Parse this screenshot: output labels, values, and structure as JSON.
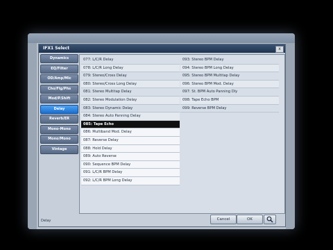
{
  "dialog": {
    "title": "IFX1 Select",
    "close_label": "x"
  },
  "categories": [
    "Dynamics",
    "EQ/Filter",
    "OD/Amp/Mic",
    "Cho/Flg/Phs",
    "Mod/P.Shift",
    "Delay",
    "Reverb/ER",
    "Mono-Mono",
    "Mono/Mono",
    "Vintage"
  ],
  "active_category": "Delay",
  "effects_left": [
    "077: L/C/R Delay",
    "078: L/C/R Long Delay",
    "079: Stereo/Cross Delay",
    "080: Stereo/Cross Long Delay",
    "081: Stereo Multitap Delay",
    "082: Stereo Modulation Delay",
    "083: Stereo Dynamic Delay",
    "084: Stereo Auto Panning Delay",
    "085: Tape Echo",
    "086: Multiband Mod. Delay",
    "087: Reverse Delay",
    "088: Hold Delay",
    "089: Auto Reverse",
    "090: Sequence BPM Delay",
    "091: L/C/R BPM Delay",
    "092: L/C/R BPM Long Delay"
  ],
  "effects_right": [
    "093: Stereo BPM Delay",
    "094: Stereo BPM Long Delay",
    "095: Stereo BPM Multitap Delay",
    "096: Stereo BPM Mod. Delay",
    "097: St. BPM Auto Panning Dly",
    "098: Tape Echo BPM",
    "099: Reverse BPM Delay"
  ],
  "selected_effect": "085: Tape Echo",
  "footer": {
    "status": "Delay",
    "cancel_label": "Cancel",
    "ok_label": "OK",
    "search_icon": "magnifier-icon"
  }
}
